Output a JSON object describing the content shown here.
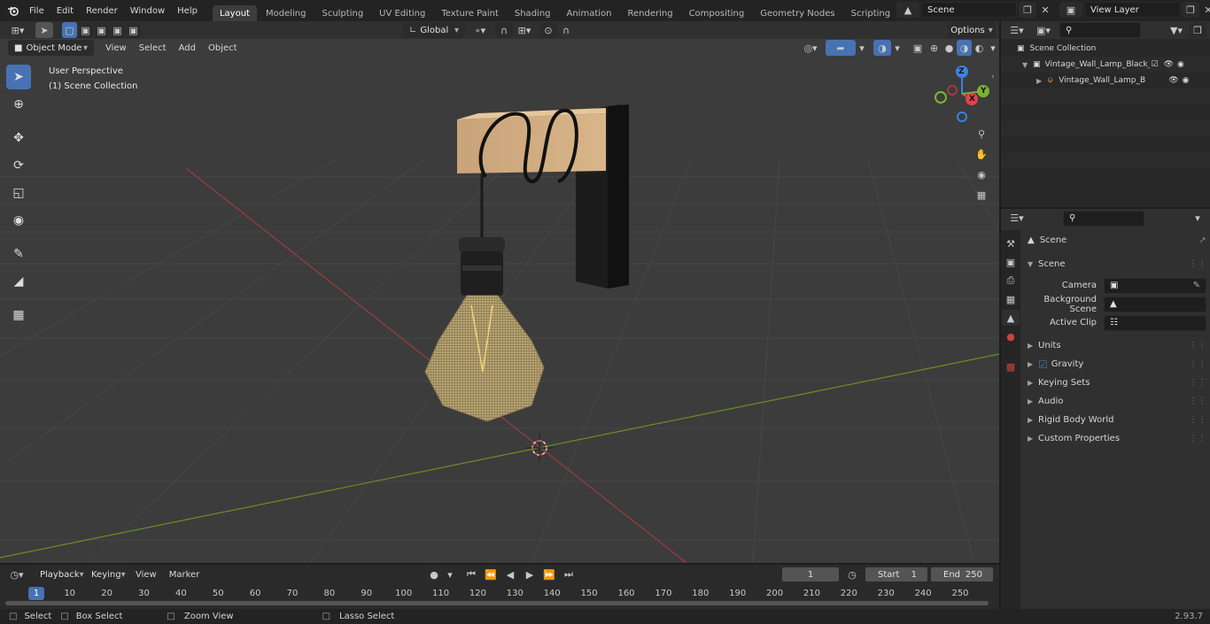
{
  "menus": [
    "File",
    "Edit",
    "Render",
    "Window",
    "Help"
  ],
  "workspaces": [
    "Layout",
    "Modeling",
    "Sculpting",
    "UV Editing",
    "Texture Paint",
    "Shading",
    "Animation",
    "Rendering",
    "Compositing",
    "Geometry Nodes",
    "Scripting"
  ],
  "active_workspace": "Layout",
  "scene_name": "Scene",
  "view_layer": "View Layer",
  "header": {
    "mode": "Object Mode",
    "view": "View",
    "select": "Select",
    "add": "Add",
    "object": "Object",
    "transform_orientation": "Global",
    "options": "Options"
  },
  "viewport": {
    "perspective": "User Perspective",
    "collection": "(1) Scene Collection",
    "gizmo": {
      "x": "X",
      "y": "Y",
      "z": "Z"
    }
  },
  "outliner": {
    "root": "Scene Collection",
    "items": [
      {
        "label": "Vintage_Wall_Lamp_Black_w"
      },
      {
        "label": "Vintage_Wall_Lamp_Blac"
      }
    ]
  },
  "properties": {
    "context": "Scene",
    "panel": "Scene",
    "camera_label": "Camera",
    "bg_scene_label": "Background Scene",
    "active_clip_label": "Active Clip",
    "sections": [
      "Units",
      "Gravity",
      "Keying Sets",
      "Audio",
      "Rigid Body World",
      "Custom Properties"
    ]
  },
  "timeline": {
    "playback": "Playback",
    "keying": "Keying",
    "view": "View",
    "marker": "Marker",
    "current_frame": "1",
    "start_label": "Start",
    "start": "1",
    "end_label": "End",
    "end": "250",
    "ticks": [
      "1",
      "10",
      "20",
      "30",
      "40",
      "50",
      "60",
      "70",
      "80",
      "90",
      "100",
      "110",
      "120",
      "130",
      "140",
      "150",
      "160",
      "170",
      "180",
      "190",
      "200",
      "210",
      "220",
      "230",
      "240",
      "250"
    ]
  },
  "status": {
    "select": "Select",
    "box_select": "Box Select",
    "zoom_view": "Zoom View",
    "lasso_select": "Lasso Select",
    "version": "2.93.7"
  },
  "colors": {
    "accent": "#4772b3",
    "x_axis": "#e0434d",
    "y_axis": "#7bb332",
    "z_axis": "#3b82e0"
  }
}
